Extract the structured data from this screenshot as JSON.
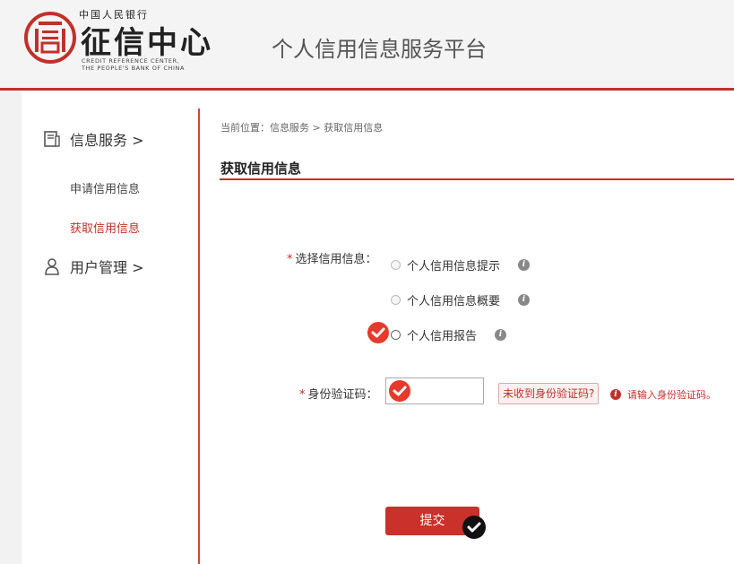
{
  "header": {
    "logo_top": "中国人民银行",
    "logo_main": "征信中心",
    "logo_en_line1": "CREDIT REFERENCE CENTER,",
    "logo_en_line2": "THE PEOPLE'S BANK OF CHINA",
    "platform_title": "个人信用信息服务平台",
    "brand_color": "#c0312b"
  },
  "sidebar": {
    "group1": {
      "label": "信息服务 >",
      "icon": "document-icon"
    },
    "items": [
      {
        "label": "申请信用信息",
        "active": false
      },
      {
        "label": "获取信用信息",
        "active": true
      }
    ],
    "group2": {
      "label": "用户管理 >",
      "icon": "user-icon"
    }
  },
  "main": {
    "breadcrumb": "当前位置：信息服务 > 获取信用信息",
    "title": "获取信用信息",
    "select_label": "选择信用信息：",
    "options": [
      {
        "label": "个人信用信息提示"
      },
      {
        "label": "个人信用信息概要"
      },
      {
        "label": "个人信用报告",
        "selected": true
      }
    ],
    "code_label": "身份验证码：",
    "code_value": "",
    "not_received": "未收到身份验证码?",
    "error_msg": "请输入身份验证码。",
    "submit": "提交",
    "required_mark": "*"
  }
}
